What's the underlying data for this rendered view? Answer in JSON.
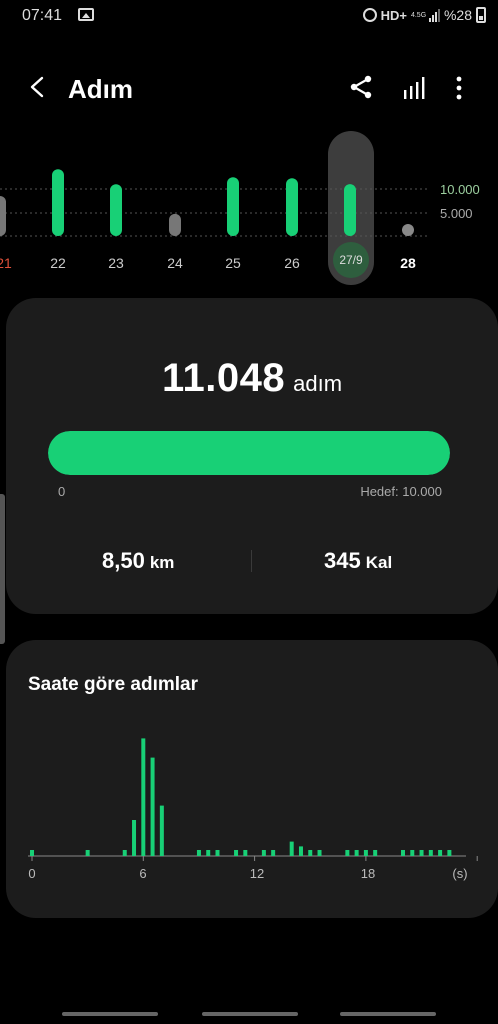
{
  "status_bar": {
    "time": "07:41",
    "network": "HD+",
    "network_gen": "4.5G",
    "battery": "%28"
  },
  "header": {
    "title": "Adım"
  },
  "daily_chart": {
    "guides": [
      "10.000",
      "5.000"
    ],
    "days": [
      {
        "label": "21",
        "steps": 8500,
        "met_goal": false,
        "partial": true
      },
      {
        "label": "22",
        "steps": 14200,
        "met_goal": true
      },
      {
        "label": "23",
        "steps": 11000,
        "met_goal": true
      },
      {
        "label": "24",
        "steps": 4700,
        "met_goal": false
      },
      {
        "label": "25",
        "steps": 12500,
        "met_goal": true
      },
      {
        "label": "26",
        "steps": 12300,
        "met_goal": true
      },
      {
        "label": "27/9",
        "steps": 11048,
        "met_goal": true,
        "selected": true
      },
      {
        "label": "28",
        "steps": 0,
        "met_goal": false,
        "today": true
      }
    ],
    "colors": {
      "goal": "#18d076",
      "below": "#777777",
      "empty": "#888888"
    }
  },
  "summary": {
    "steps": "11.048",
    "steps_unit": "adım",
    "progress_fraction": 1.0,
    "progress_min": "0",
    "goal_label": "Hedef: 10.000",
    "distance": "8,50",
    "distance_unit": "km",
    "calories": "345",
    "calories_unit": "Kal"
  },
  "hourly": {
    "title": "Saate göre adımlar",
    "ticks": [
      "0",
      "6",
      "12",
      "18",
      "(s)"
    ],
    "accent": "#18d076",
    "bars": [
      {
        "hour": 0,
        "steps": 50
      },
      {
        "hour": 3,
        "steps": 50
      },
      {
        "hour": 5,
        "steps": 40
      },
      {
        "hour": 5.5,
        "steps": 300
      },
      {
        "hour": 6,
        "steps": 980
      },
      {
        "hour": 6.5,
        "steps": 820
      },
      {
        "hour": 7,
        "steps": 420
      },
      {
        "hour": 9,
        "steps": 40
      },
      {
        "hour": 9.5,
        "steps": 40
      },
      {
        "hour": 10,
        "steps": 40
      },
      {
        "hour": 11,
        "steps": 40
      },
      {
        "hour": 11.5,
        "steps": 40
      },
      {
        "hour": 12.5,
        "steps": 40
      },
      {
        "hour": 13,
        "steps": 40
      },
      {
        "hour": 14,
        "steps": 120
      },
      {
        "hour": 14.5,
        "steps": 80
      },
      {
        "hour": 15,
        "steps": 40
      },
      {
        "hour": 15.5,
        "steps": 40
      },
      {
        "hour": 17,
        "steps": 40
      },
      {
        "hour": 17.5,
        "steps": 40
      },
      {
        "hour": 18,
        "steps": 40
      },
      {
        "hour": 18.5,
        "steps": 40
      },
      {
        "hour": 20,
        "steps": 40
      },
      {
        "hour": 20.5,
        "steps": 40
      },
      {
        "hour": 21,
        "steps": 40
      },
      {
        "hour": 21.5,
        "steps": 40
      },
      {
        "hour": 22,
        "steps": 40
      },
      {
        "hour": 22.5,
        "steps": 40
      }
    ]
  }
}
